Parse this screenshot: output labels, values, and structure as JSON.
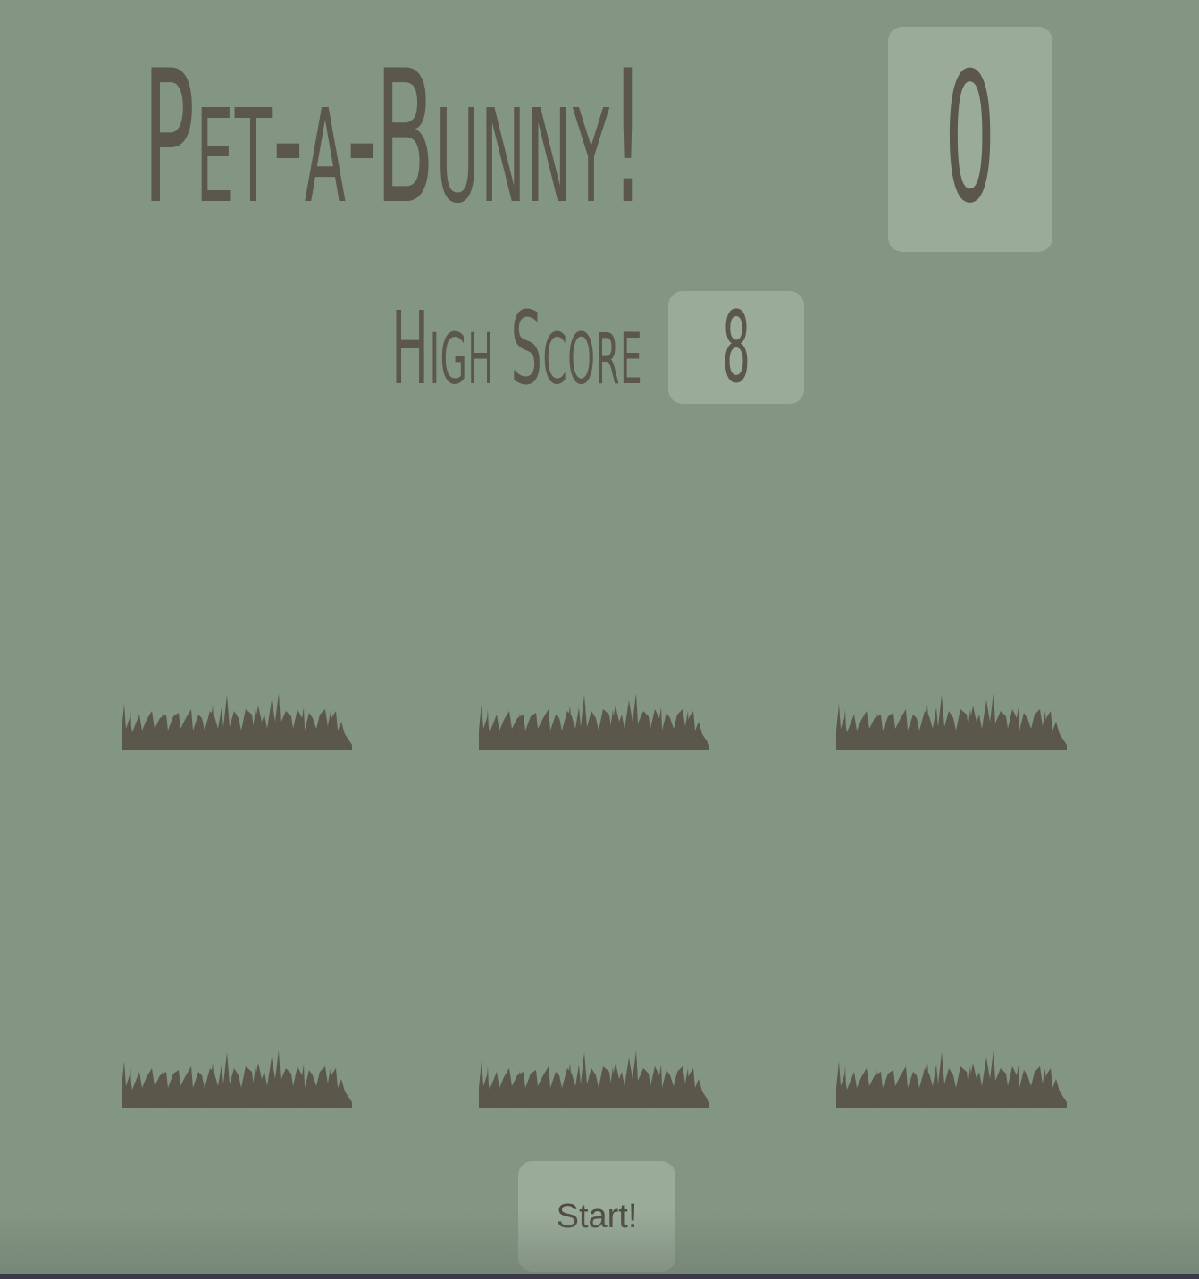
{
  "game": {
    "title": "Pet-a-Bunny!",
    "score": "0",
    "high_score_label": "High Score",
    "high_score": "8",
    "start_label": "Start!"
  },
  "holes": [
    {
      "id": 1,
      "icon": "grass-icon"
    },
    {
      "id": 2,
      "icon": "grass-icon"
    },
    {
      "id": 3,
      "icon": "grass-icon"
    },
    {
      "id": 4,
      "icon": "grass-icon"
    },
    {
      "id": 5,
      "icon": "grass-icon"
    },
    {
      "id": 6,
      "icon": "grass-icon"
    }
  ],
  "colors": {
    "background": "#839583",
    "panel": "#9aab9a",
    "text": "#5b574b",
    "grass": "#5b574b"
  }
}
